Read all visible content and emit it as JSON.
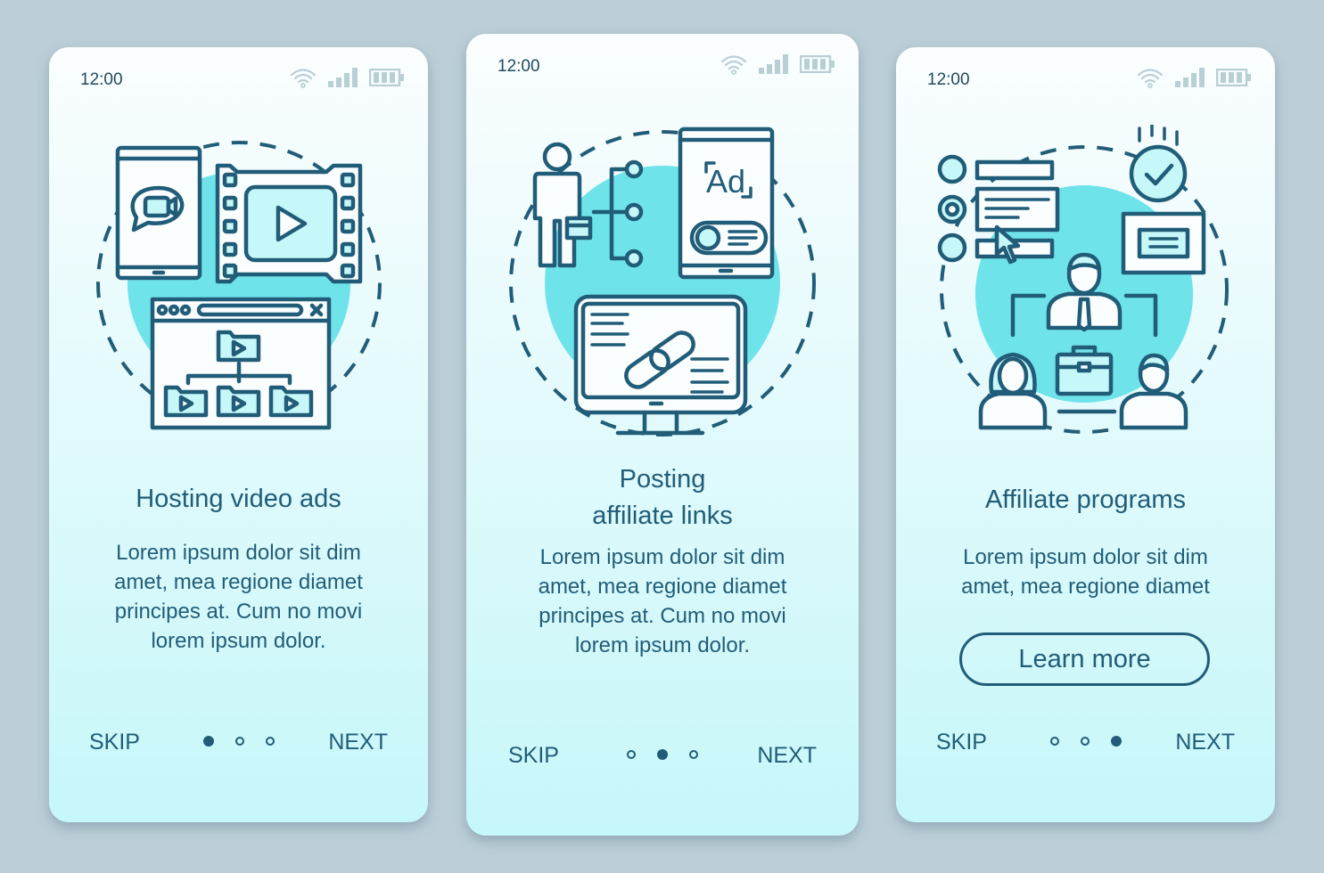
{
  "colors": {
    "background": "#bccfd8",
    "accent": "#215d78",
    "highlight": "#6fe3ea",
    "status_icons": "#b9cfd6"
  },
  "screens": [
    {
      "status": {
        "time": "12:00",
        "icons": [
          "wifi-icon",
          "signal-icon",
          "battery-icon"
        ]
      },
      "illustration": "hosting-video-ads-illustration",
      "title": "Hosting  video ads",
      "body": [
        "Lorem ipsum dolor sit dim",
        "amet, mea regione diamet",
        "principes at. Cum no movi",
        "lorem ipsum dolor."
      ],
      "footer": {
        "skip": "SKIP",
        "next": "NEXT",
        "page": 1,
        "total": 3
      }
    },
    {
      "status": {
        "time": "12:00",
        "icons": [
          "wifi-icon",
          "signal-icon",
          "battery-icon"
        ]
      },
      "illustration": "posting-affiliate-links-illustration",
      "title_lines": [
        "Posting",
        "affiliate links"
      ],
      "ad_label": "Ad",
      "body": [
        "Lorem ipsum dolor sit dim",
        "amet, mea regione diamet",
        "principes at. Cum no movi",
        "lorem ipsum dolor."
      ],
      "footer": {
        "skip": "SKIP",
        "next": "NEXT",
        "page": 2,
        "total": 3
      }
    },
    {
      "status": {
        "time": "12:00",
        "icons": [
          "wifi-icon",
          "signal-icon",
          "battery-icon"
        ]
      },
      "illustration": "affiliate-programs-illustration",
      "title": "Affiliate programs",
      "body": [
        "Lorem ipsum dolor sit dim",
        "amet, mea regione diamet"
      ],
      "button": "Learn more",
      "footer": {
        "skip": "SKIP",
        "next": "NEXT",
        "page": 3,
        "total": 3
      }
    }
  ]
}
